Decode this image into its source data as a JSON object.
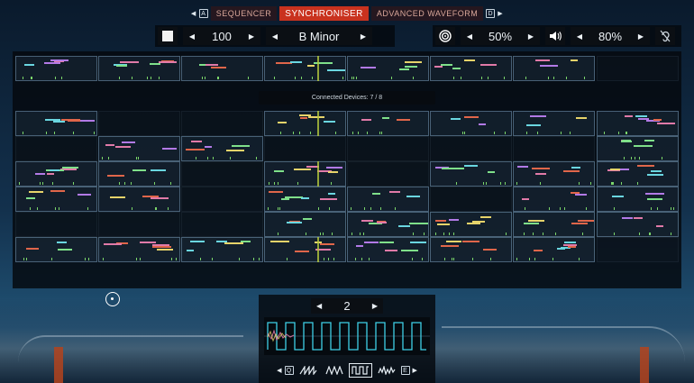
{
  "tabs": {
    "left_key": "A",
    "right_key": "D",
    "items": [
      {
        "label": "Sequencer",
        "active": false
      },
      {
        "label": "Synchroniser",
        "active": true
      },
      {
        "label": "Advanced Waveform",
        "active": false
      }
    ]
  },
  "controls": {
    "tempo": "100",
    "key": "B Minor",
    "volume_a": "50%",
    "volume_b": "80%",
    "icons": [
      "stop-square-icon",
      "target-icon",
      "speaker-icon",
      "ear-icon"
    ]
  },
  "status": "Connected Devices: 7 / 8",
  "waveform": {
    "octave": "2",
    "left_key": "Q",
    "right_key": "E",
    "selected_index": 2,
    "shapes": [
      "sawtooth",
      "triangle",
      "square",
      "noise"
    ]
  },
  "colors": {
    "accent": "#c9321e",
    "note_green": "#7fe08a",
    "note_yellow": "#e6d36a",
    "note_pink": "#e07aa8",
    "note_purple": "#b27ae6",
    "note_cyan": "#6ad6e0",
    "note_red": "#e0664a",
    "wave_cyan": "#3fd0e6"
  }
}
